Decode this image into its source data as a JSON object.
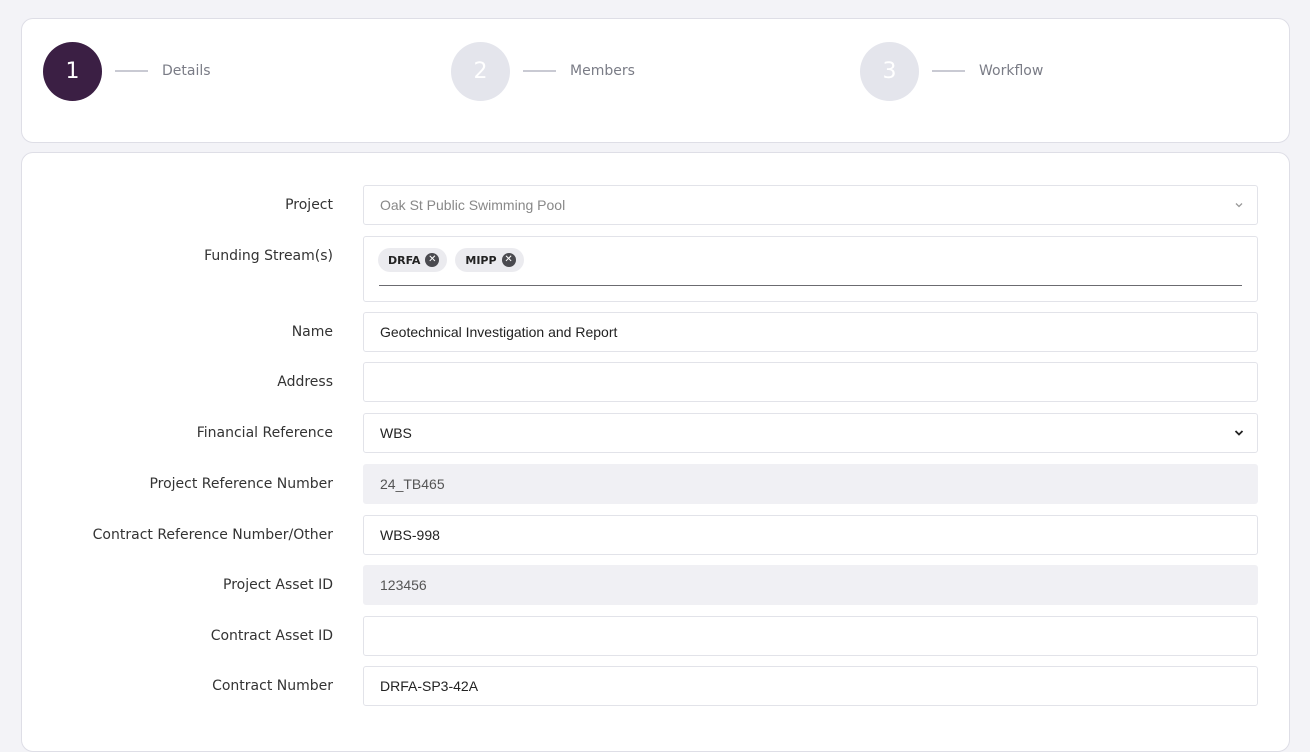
{
  "stepper": {
    "steps": [
      {
        "number": "1",
        "label": "Details"
      },
      {
        "number": "2",
        "label": "Members"
      },
      {
        "number": "3",
        "label": "Workflow"
      }
    ]
  },
  "form": {
    "project": {
      "label": "Project",
      "value": "Oak St Public Swimming Pool"
    },
    "funding": {
      "label": "Funding Stream(s)",
      "chips": [
        "DRFA",
        "MIPP"
      ]
    },
    "name": {
      "label": "Name",
      "value": "Geotechnical Investigation and Report"
    },
    "address": {
      "label": "Address",
      "value": ""
    },
    "financial_reference": {
      "label": "Financial Reference",
      "value": "WBS"
    },
    "project_reference_number": {
      "label": "Project Reference Number",
      "value": "24_TB465"
    },
    "contract_reference_number": {
      "label": "Contract Reference Number/Other",
      "value": "WBS-998"
    },
    "project_asset_id": {
      "label": "Project Asset ID",
      "value": "123456"
    },
    "contract_asset_id": {
      "label": "Contract Asset ID",
      "value": ""
    },
    "contract_number": {
      "label": "Contract Number",
      "value": "DRFA-SP3-42A"
    }
  }
}
